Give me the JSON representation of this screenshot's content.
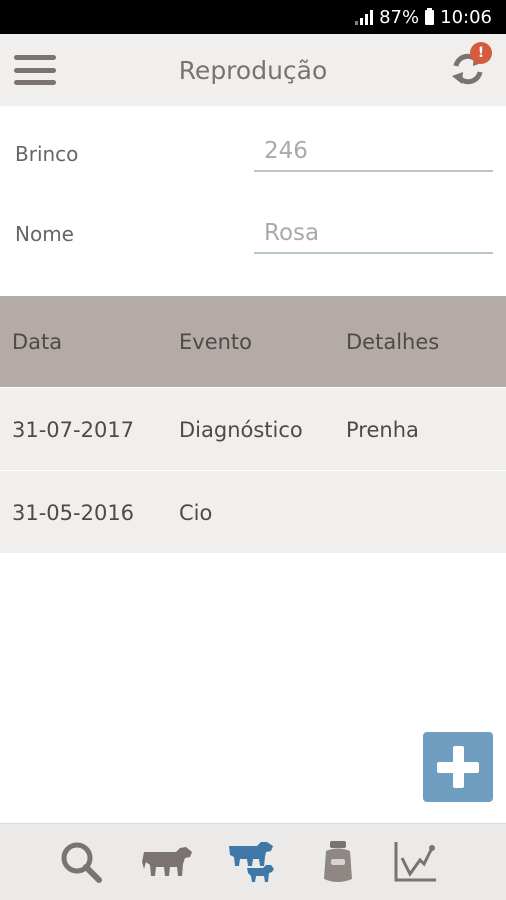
{
  "status_bar": {
    "battery": "87%",
    "time": "10:06"
  },
  "header": {
    "title": "Reprodução",
    "sync_badge": "!"
  },
  "form": {
    "brinco": {
      "label": "Brinco",
      "value": "246"
    },
    "nome": {
      "label": "Nome",
      "value": "Rosa"
    }
  },
  "table": {
    "columns": [
      "Data",
      "Evento",
      "Detalhes"
    ],
    "rows": [
      [
        "31-07-2017",
        "Diagnóstico",
        "Prenha"
      ],
      [
        "31-05-2016",
        "Cio",
        ""
      ]
    ]
  },
  "fab": {
    "icon": "plus-icon"
  },
  "bottom_nav": {
    "items": [
      {
        "icon": "search-icon",
        "active": false
      },
      {
        "icon": "cow-icon",
        "active": false
      },
      {
        "icon": "cow-calf-icon",
        "active": true
      },
      {
        "icon": "milk-can-icon",
        "active": false
      },
      {
        "icon": "chart-icon",
        "active": false
      }
    ]
  },
  "colors": {
    "accent": "#6f9ec0",
    "header_bg": "#f1efed",
    "table_header": "#b4aaa7",
    "badge": "#d45b3c"
  }
}
